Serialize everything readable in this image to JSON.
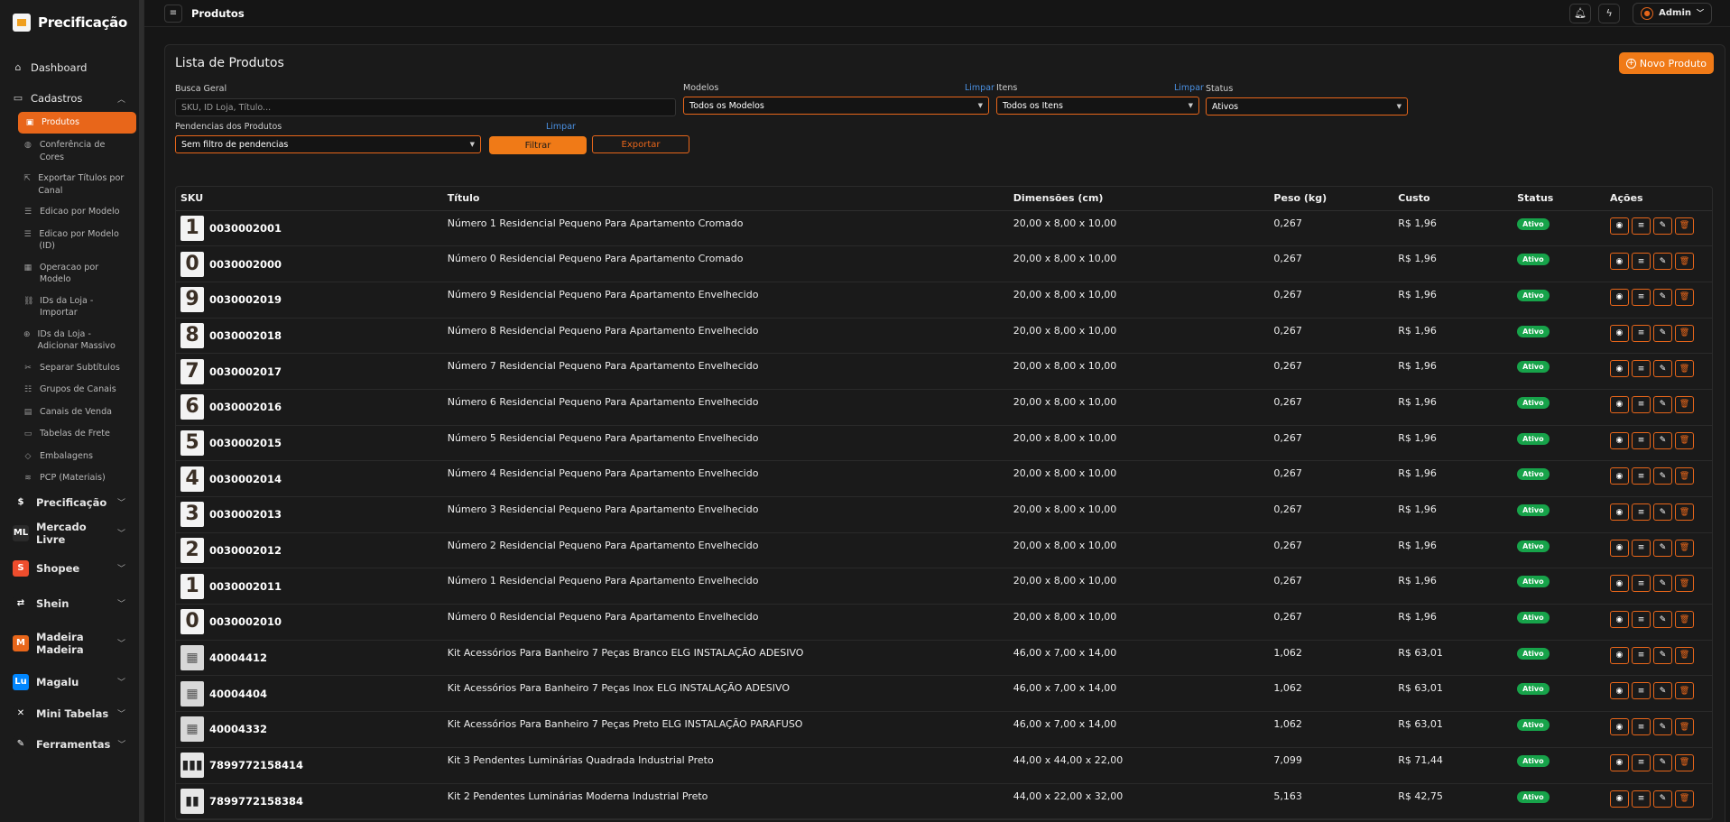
{
  "brand": {
    "title": "Precificação"
  },
  "sidebar": {
    "dashboard": "Dashboard",
    "cadastros": "Cadastros",
    "sub_items": [
      {
        "label": "Produtos",
        "icon": "box-icon"
      },
      {
        "label": "Conferência de Cores",
        "icon": "palette-icon"
      },
      {
        "label": "Exportar Títulos por Canal",
        "icon": "export-icon"
      },
      {
        "label": "Edicao por Modelo",
        "icon": "sliders-icon"
      },
      {
        "label": "Edicao por Modelo (ID)",
        "icon": "sliders-icon"
      },
      {
        "label": "Operacao por Modelo",
        "icon": "grid-icon"
      },
      {
        "label": "IDs da Loja - Importar",
        "icon": "link-icon"
      },
      {
        "label": "IDs da Loja - Adicionar Massivo",
        "icon": "add-link-icon"
      },
      {
        "label": "Separar Subtítulos",
        "icon": "scissors-icon"
      },
      {
        "label": "Grupos de Canais",
        "icon": "group-icon"
      },
      {
        "label": "Canais de Venda",
        "icon": "store-icon"
      },
      {
        "label": "Tabelas de Frete",
        "icon": "truck-icon"
      },
      {
        "label": "Embalagens",
        "icon": "package-icon"
      },
      {
        "label": "PCP (Materiais)",
        "icon": "layers-icon"
      }
    ],
    "groups": [
      {
        "label": "Precificação",
        "icon": "$",
        "color": "#1b1b1b"
      },
      {
        "label": "Mercado Livre",
        "icon": "ML",
        "color": "#2a2a2a"
      },
      {
        "label": "Shopee",
        "icon": "S",
        "color": "#ee4d2d"
      },
      {
        "label": "Shein",
        "icon": "⇄",
        "color": "#1b1b1b"
      },
      {
        "label": "Madeira Madeira",
        "icon": "M",
        "color": "#e8661a"
      },
      {
        "label": "Magalu",
        "icon": "Lu",
        "color": "#0086ff"
      },
      {
        "label": "Mini Tabelas",
        "icon": "✕",
        "color": "#1b1b1b"
      },
      {
        "label": "Ferramentas",
        "icon": "✎",
        "color": "#1b1b1b"
      }
    ]
  },
  "header": {
    "title": "Produtos",
    "user": "Admin"
  },
  "card": {
    "title": "Lista de Produtos",
    "new_button": "Novo Produto"
  },
  "filters": {
    "busca_label": "Busca Geral",
    "busca_placeholder": "SKU, ID Loja, Título...",
    "modelos_label": "Modelos",
    "modelos_clear": "Limpar",
    "modelos_value": "Todos os Modelos",
    "itens_label": "Itens",
    "itens_clear": "Limpar",
    "itens_value": "Todos os Itens",
    "status_label": "Status",
    "status_value": "Ativos",
    "pend_label": "Pendencias dos Produtos",
    "pend_clear": "Limpar",
    "pend_value": "Sem filtro de pendencias",
    "filter_button": "Filtrar",
    "export_button": "Exportar"
  },
  "table": {
    "headers": [
      "SKU",
      "Título",
      "Dimensões (cm)",
      "Peso (kg)",
      "Custo",
      "Status",
      "Ações"
    ],
    "rows": [
      {
        "thumb": "1",
        "type": "num",
        "sku": "0030002001",
        "title": "Número 1 Residencial Pequeno Para Apartamento Cromado",
        "dims": "20,00 x 8,00 x 10,00",
        "peso": "0,267",
        "custo": "R$ 1,96",
        "status": "Ativo"
      },
      {
        "thumb": "0",
        "type": "num",
        "sku": "0030002000",
        "title": "Número 0 Residencial Pequeno Para Apartamento Cromado",
        "dims": "20,00 x 8,00 x 10,00",
        "peso": "0,267",
        "custo": "R$ 1,96",
        "status": "Ativo"
      },
      {
        "thumb": "9",
        "type": "num",
        "sku": "0030002019",
        "title": "Número 9 Residencial Pequeno Para Apartamento Envelhecido",
        "dims": "20,00 x 8,00 x 10,00",
        "peso": "0,267",
        "custo": "R$ 1,96",
        "status": "Ativo"
      },
      {
        "thumb": "8",
        "type": "num",
        "sku": "0030002018",
        "title": "Número 8 Residencial Pequeno Para Apartamento Envelhecido",
        "dims": "20,00 x 8,00 x 10,00",
        "peso": "0,267",
        "custo": "R$ 1,96",
        "status": "Ativo"
      },
      {
        "thumb": "7",
        "type": "num",
        "sku": "0030002017",
        "title": "Número 7 Residencial Pequeno Para Apartamento Envelhecido",
        "dims": "20,00 x 8,00 x 10,00",
        "peso": "0,267",
        "custo": "R$ 1,96",
        "status": "Ativo"
      },
      {
        "thumb": "6",
        "type": "num",
        "sku": "0030002016",
        "title": "Número 6 Residencial Pequeno Para Apartamento Envelhecido",
        "dims": "20,00 x 8,00 x 10,00",
        "peso": "0,267",
        "custo": "R$ 1,96",
        "status": "Ativo"
      },
      {
        "thumb": "5",
        "type": "num",
        "sku": "0030002015",
        "title": "Número 5 Residencial Pequeno Para Apartamento Envelhecido",
        "dims": "20,00 x 8,00 x 10,00",
        "peso": "0,267",
        "custo": "R$ 1,96",
        "status": "Ativo"
      },
      {
        "thumb": "4",
        "type": "num",
        "sku": "0030002014",
        "title": "Número 4 Residencial Pequeno Para Apartamento Envelhecido",
        "dims": "20,00 x 8,00 x 10,00",
        "peso": "0,267",
        "custo": "R$ 1,96",
        "status": "Ativo"
      },
      {
        "thumb": "3",
        "type": "num",
        "sku": "0030002013",
        "title": "Número 3 Residencial Pequeno Para Apartamento Envelhecido",
        "dims": "20,00 x 8,00 x 10,00",
        "peso": "0,267",
        "custo": "R$ 1,96",
        "status": "Ativo"
      },
      {
        "thumb": "2",
        "type": "num",
        "sku": "0030002012",
        "title": "Número 2 Residencial Pequeno Para Apartamento Envelhecido",
        "dims": "20,00 x 8,00 x 10,00",
        "peso": "0,267",
        "custo": "R$ 1,96",
        "status": "Ativo"
      },
      {
        "thumb": "1",
        "type": "num",
        "sku": "0030002011",
        "title": "Número 1 Residencial Pequeno Para Apartamento Envelhecido",
        "dims": "20,00 x 8,00 x 10,00",
        "peso": "0,267",
        "custo": "R$ 1,96",
        "status": "Ativo"
      },
      {
        "thumb": "0",
        "type": "num",
        "sku": "0030002010",
        "title": "Número 0 Residencial Pequeno Para Apartamento Envelhecido",
        "dims": "20,00 x 8,00 x 10,00",
        "peso": "0,267",
        "custo": "R$ 1,96",
        "status": "Ativo"
      },
      {
        "thumb": "▦",
        "type": "kit",
        "sku": "40004412",
        "title": "Kit Acessórios Para Banheiro 7 Peças Branco ELG INSTALAÇÃO ADESIVO",
        "dims": "46,00 x 7,00 x 14,00",
        "peso": "1,062",
        "custo": "R$ 63,01",
        "status": "Ativo"
      },
      {
        "thumb": "▦",
        "type": "kit",
        "sku": "40004404",
        "title": "Kit Acessórios Para Banheiro 7 Peças Inox ELG INSTALAÇÃO ADESIVO",
        "dims": "46,00 x 7,00 x 14,00",
        "peso": "1,062",
        "custo": "R$ 63,01",
        "status": "Ativo"
      },
      {
        "thumb": "▦",
        "type": "kit",
        "sku": "40004332",
        "title": "Kit Acessórios Para Banheiro 7 Peças Preto ELG INSTALAÇÃO PARAFUSO",
        "dims": "46,00 x 7,00 x 14,00",
        "peso": "1,062",
        "custo": "R$ 63,01",
        "status": "Ativo"
      },
      {
        "thumb": "▮▮▮",
        "type": "lamp",
        "sku": "7899772158414",
        "title": "Kit 3 Pendentes Luminárias Quadrada Industrial Preto",
        "dims": "44,00 x 44,00 x 22,00",
        "peso": "7,099",
        "custo": "R$ 71,44",
        "status": "Ativo"
      },
      {
        "thumb": "▮▮",
        "type": "lamp",
        "sku": "7899772158384",
        "title": "Kit 2 Pendentes Luminárias Moderna Industrial Preto",
        "dims": "44,00 x 22,00 x 32,00",
        "peso": "5,163",
        "custo": "R$ 42,75",
        "status": "Ativo"
      }
    ]
  },
  "colors": {
    "accent": "#f07a17",
    "active_badge": "#17a34a",
    "link": "#4a90e2"
  }
}
